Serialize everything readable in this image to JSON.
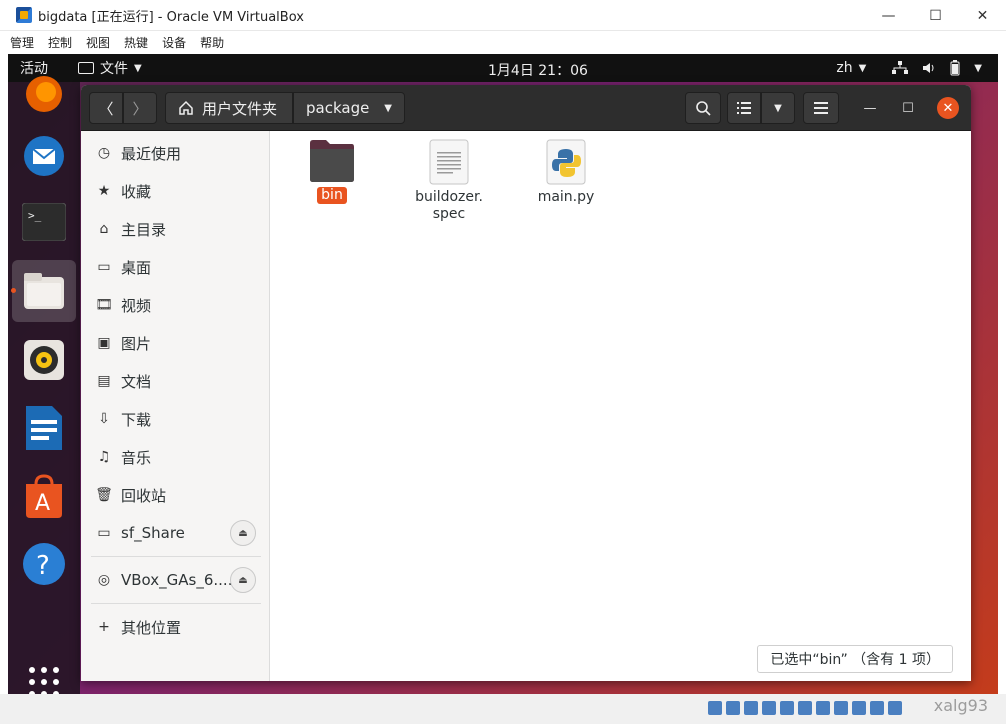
{
  "host": {
    "title": "bigdata [正在运行] - Oracle VM VirtualBox",
    "menu": [
      "管理",
      "控制",
      "视图",
      "热键",
      "设备",
      "帮助"
    ],
    "win_buttons": [
      "—",
      "☐",
      "✕"
    ],
    "watermark": "xalg93"
  },
  "topbar": {
    "activities": "活动",
    "app_menu": "文件",
    "clock": "1月4日  21：06",
    "input_method": "zh"
  },
  "dock": {
    "icons": [
      "firefox-icon",
      "thunderbird-icon",
      "terminal-icon",
      "files-icon",
      "rhythmbox-icon",
      "writer-icon",
      "software-icon",
      "help-icon",
      "show-apps-icon"
    ]
  },
  "headerbar": {
    "home_label": "用户文件夹",
    "current_folder": "package"
  },
  "sidebar": {
    "items": [
      {
        "label": "最近使用",
        "icon": "clock-icon"
      },
      {
        "label": "收藏",
        "icon": "star-icon"
      },
      {
        "label": "主目录",
        "icon": "home-icon"
      },
      {
        "label": "桌面",
        "icon": "desktop-icon"
      },
      {
        "label": "视频",
        "icon": "video-icon"
      },
      {
        "label": "图片",
        "icon": "picture-icon"
      },
      {
        "label": "文档",
        "icon": "document-icon"
      },
      {
        "label": "下载",
        "icon": "download-icon"
      },
      {
        "label": "音乐",
        "icon": "music-icon"
      },
      {
        "label": "回收站",
        "icon": "trash-icon"
      }
    ],
    "devices": [
      {
        "label": "sf_Share",
        "icon": "drive-icon"
      },
      {
        "label": "VBox_GAs_6....",
        "icon": "disc-icon"
      }
    ],
    "other": "其他位置"
  },
  "files": [
    {
      "name": "bin",
      "type": "folder",
      "selected": true
    },
    {
      "name": "buildozer.\nspec",
      "type": "text",
      "selected": false
    },
    {
      "name": "main.py",
      "type": "python",
      "selected": false
    }
  ],
  "status": "已选中“bin” （含有 1 项）"
}
